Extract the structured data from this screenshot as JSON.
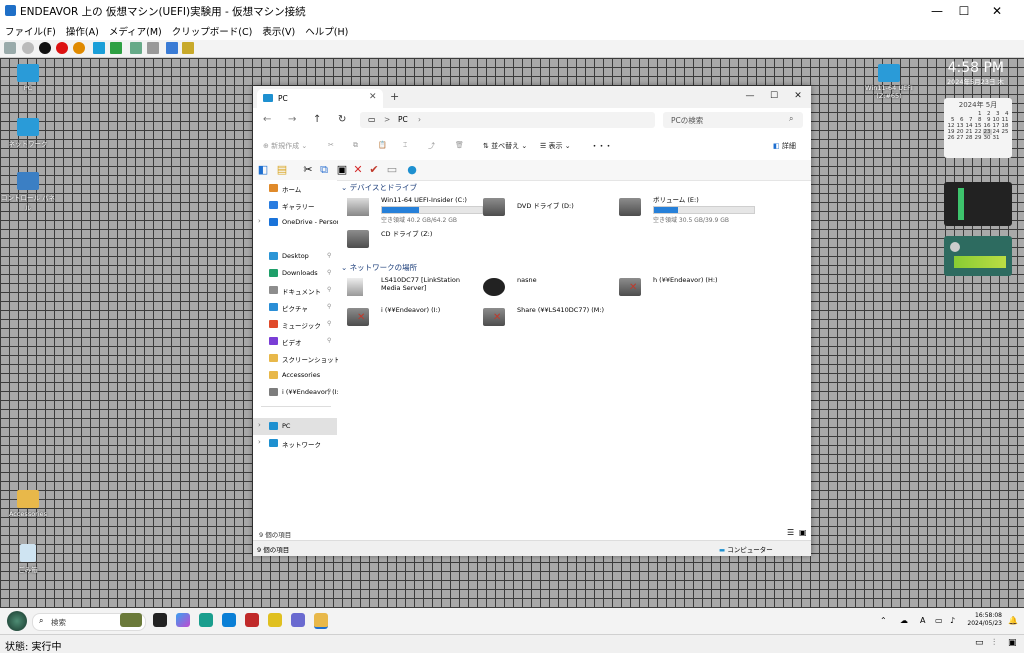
{
  "host": {
    "window_title": "ENDEAVOR 上の 仮想マシン(UEFI)実験用  - 仮想マシン接続",
    "menu": [
      "ファイル(F)",
      "操作(A)",
      "メディア(M)",
      "クリップボード(C)",
      "表示(V)",
      "ヘルプ(H)"
    ],
    "status": "状態: 実行中"
  },
  "desktop": {
    "icons": [
      {
        "label": "PC",
        "icon": "pc-icon"
      },
      {
        "label": "ネットワーク",
        "icon": "network-icon"
      },
      {
        "label": "コントロール パネル",
        "icon": "control-panel-icon"
      },
      {
        "label": "Accessories",
        "icon": "folder-icon"
      },
      {
        "label": "ごみ箱",
        "icon": "recycle-bin-icon"
      },
      {
        "label": "Win11-64 UEFI (Z:#65)",
        "icon": "windows-drive-icon"
      }
    ],
    "clock": {
      "time": "4:58 PM",
      "date": "2024年5月23日 木"
    },
    "calendar": {
      "header": "2024年 5月",
      "rows": [
        [
          "",
          "",
          "",
          "1",
          "2",
          "3",
          "4"
        ],
        [
          "5",
          "6",
          "7",
          "8",
          "9",
          "10",
          "11"
        ],
        [
          "12",
          "13",
          "14",
          "15",
          "16",
          "17",
          "18"
        ],
        [
          "19",
          "20",
          "21",
          "22",
          "23",
          "24",
          "25"
        ],
        [
          "26",
          "27",
          "28",
          "29",
          "30",
          "31",
          ""
        ]
      ]
    }
  },
  "explorer": {
    "tab_label": "PC",
    "nav": {
      "address": "PC",
      "address_sep": ">",
      "search_placeholder": "PCの検索"
    },
    "commands": {
      "new": "新規作成",
      "sort": "並べ替え",
      "view": "表示",
      "more": "・・・",
      "details": "詳細"
    },
    "nav_pane": [
      {
        "label": "ホーム",
        "icon": "home-icon",
        "color": "#e08a2a"
      },
      {
        "label": "ギャラリー",
        "icon": "gallery-icon",
        "color": "#2a7de0"
      },
      {
        "label": "OneDrive - Persona",
        "icon": "onedrive-icon",
        "color": "#1a73d9"
      },
      {
        "label": "Desktop",
        "icon": "desktop-icon",
        "color": "#2b95d6"
      },
      {
        "label": "Downloads",
        "icon": "downloads-icon",
        "color": "#1f9f6a"
      },
      {
        "label": "ドキュメント",
        "icon": "documents-icon",
        "color": "#8d8d8d"
      },
      {
        "label": "ピクチャ",
        "icon": "pictures-icon",
        "color": "#2a8ed6"
      },
      {
        "label": "ミュージック",
        "icon": "music-icon",
        "color": "#e04a2a"
      },
      {
        "label": "ビデオ",
        "icon": "videos-icon",
        "color": "#7a3ed6"
      },
      {
        "label": "スクリーンショット",
        "icon": "folder-icon",
        "color": "#e8b84a"
      },
      {
        "label": "Accessories",
        "icon": "folder-icon",
        "color": "#e8b84a"
      },
      {
        "label": "i (¥¥Endeavor) (I:)",
        "icon": "network-drive-icon",
        "color": "#7d7d7d"
      },
      {
        "label": "PC",
        "icon": "pc-icon",
        "color": "#1e90d0"
      },
      {
        "label": "ネットワーク",
        "icon": "network-icon",
        "color": "#1e90d0"
      }
    ],
    "sections": {
      "devices": "デバイスとドライブ",
      "network": "ネットワークの場所"
    },
    "drives": [
      {
        "name": "Win11-64 UEFI-Insider (C:)",
        "size": "空き領域 40.2 GB/64.2 GB",
        "used": 0.37
      },
      {
        "name": "DVD ドライブ (D:)",
        "size": ""
      },
      {
        "name": "ボリューム (E:)",
        "size": "空き領域 30.5 GB/39.9 GB",
        "used": 0.24
      },
      {
        "name": "CD ドライブ (Z:)",
        "size": ""
      }
    ],
    "network_items": [
      {
        "name": "LS410DC77 [LinkStation Media Server]"
      },
      {
        "name": "nasne"
      },
      {
        "name": "h (¥¥Endeavor) (H:)"
      },
      {
        "name": "i (¥¥Endeavor) (I:)"
      },
      {
        "name": "Share (¥¥LS410DC77) (M:)"
      }
    ],
    "status_count": "9 個の項目",
    "status_count2": "9 個の項目",
    "status_right": "コンピューター"
  },
  "taskbar": {
    "search_placeholder": "検索",
    "time": "16:58:08",
    "date": "2024/05/23"
  }
}
